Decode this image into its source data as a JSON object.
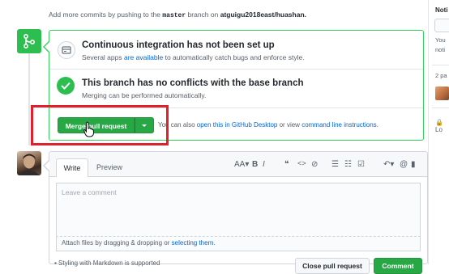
{
  "hint": {
    "prefix": "Add more commits by pushing to the",
    "branch": "master",
    "middle": "branch on",
    "repo": "atguigu2018east/huashan."
  },
  "ci": {
    "title": "Continuous integration has not been set up",
    "desc_prefix": "Several apps",
    "desc_link": "are available",
    "desc_suffix": "to automatically catch bugs and enforce style."
  },
  "conflicts": {
    "title": "This branch has no conflicts with the base branch",
    "desc": "Merging can be performed automatically."
  },
  "merge": {
    "button_label": "Merge pull request",
    "alt_prefix": "You can also",
    "alt_link1": "open this in GitHub Desktop",
    "alt_middle": "or view",
    "alt_link2": "command line instructions",
    "alt_suffix": "."
  },
  "comment": {
    "tab_write": "Write",
    "tab_preview": "Preview",
    "placeholder": "Leave a comment",
    "attach_prefix": "Attach files by dragging & dropping or",
    "attach_link": "selecting them",
    "attach_suffix": ".",
    "close_button": "Close pull request",
    "comment_button": "Comment",
    "toolbar": {
      "heading": "AA▾",
      "bold": "B",
      "italic": "I",
      "quote": "❝",
      "code": "<>",
      "link": "⊘",
      "ul": "☰",
      "ol": "☷",
      "task": "☑",
      "reply": "↶▾",
      "mention": "@",
      "bookmark": "▮"
    },
    "bottom_hint": "▪ Styling with Markdown is supported"
  },
  "sidebar": {
    "notifications": "Noti",
    "text1": "You",
    "text2": "noti",
    "participants": "2 pa",
    "lock": "🔒 Lo"
  },
  "colors": {
    "green": "#28a745",
    "link": "#0366d6",
    "annotation_red": "#e0202a"
  }
}
